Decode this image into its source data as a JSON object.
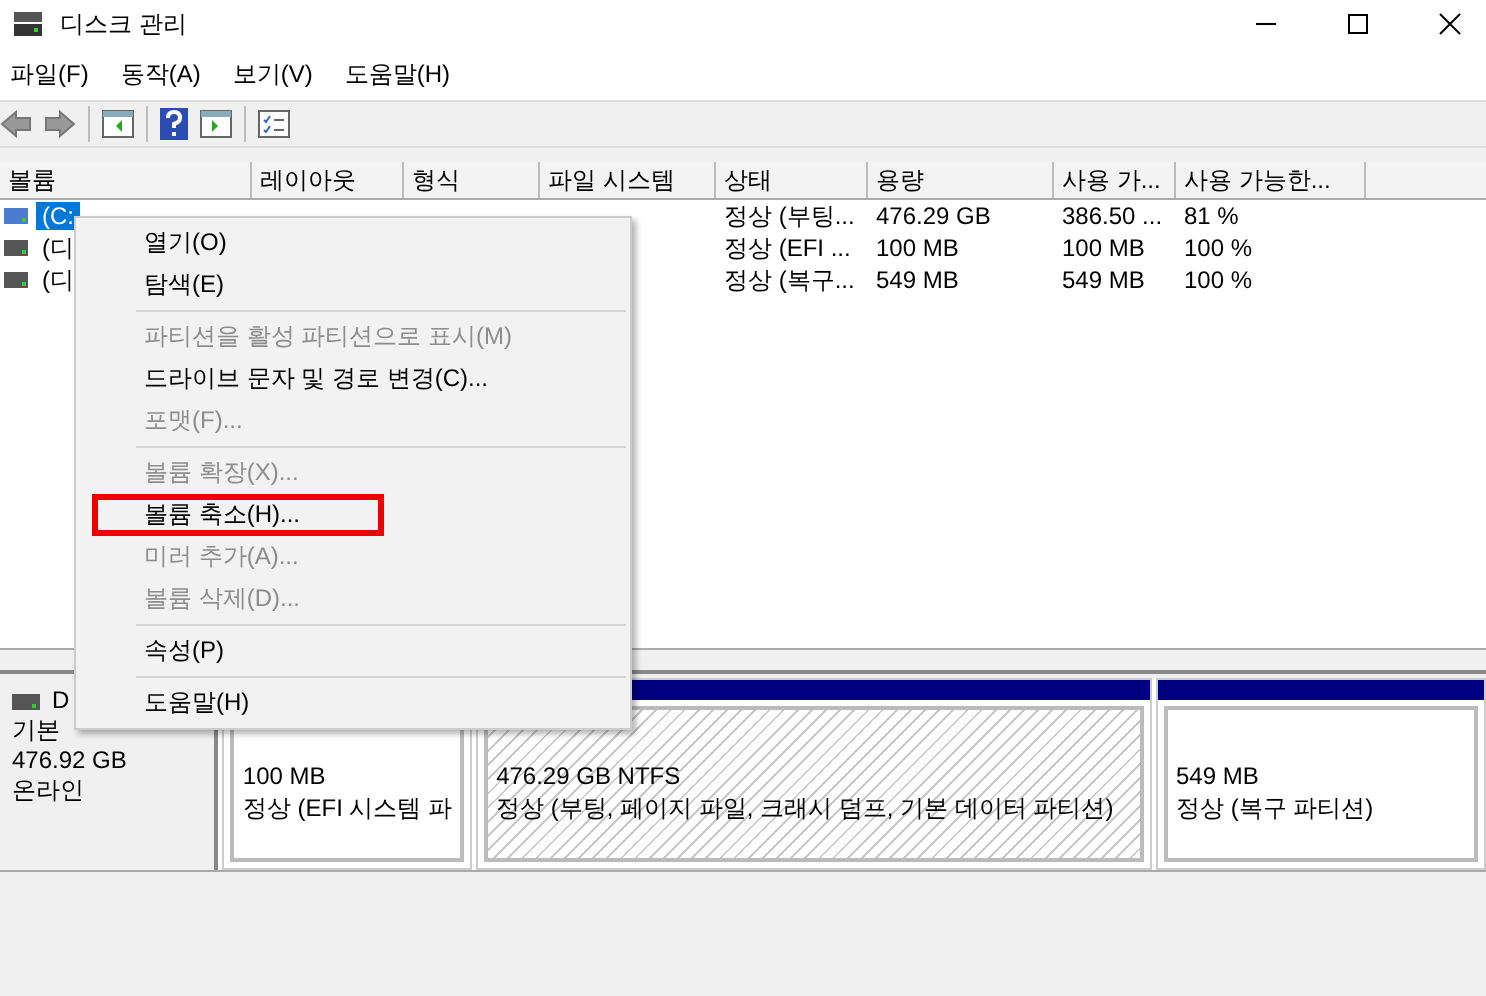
{
  "window": {
    "title": "디스크 관리"
  },
  "menu_bar": [
    "파일(F)",
    "동작(A)",
    "보기(V)",
    "도움말(H)"
  ],
  "table": {
    "columns": [
      "볼륨",
      "레이아웃",
      "형식",
      "파일 시스템",
      "상태",
      "용량",
      "사용 가...",
      "사용 가능한..."
    ],
    "rows": [
      {
        "selected": true,
        "cells": [
          "(C:",
          null,
          null,
          null,
          "정상 (부팅...",
          "476.29 GB",
          "386.50 ...",
          "81 %"
        ]
      },
      {
        "selected": false,
        "cells": [
          "(디",
          null,
          null,
          null,
          "정상 (EFI ...",
          "100 MB",
          "100 MB",
          "100 %"
        ]
      },
      {
        "selected": false,
        "cells": [
          "(디",
          null,
          null,
          null,
          "정상 (복구...",
          "549 MB",
          "549 MB",
          "100 %"
        ]
      }
    ]
  },
  "disk": {
    "name": "D",
    "type": "기본",
    "size": "476.92 GB",
    "status": "온라인",
    "partitions": [
      {
        "size": "100 MB",
        "status": "정상 (EFI 시스템 파",
        "hatched": false
      },
      {
        "size": "476.29 GB NTFS",
        "status": "정상 (부팅, 페이지 파일, 크래시 덤프, 기본 데이터 파티션)",
        "hatched": true
      },
      {
        "size": "549 MB",
        "status": "정상 (복구 파티션)",
        "hatched": false
      }
    ]
  },
  "context_menu": [
    {
      "label": "열기(O)",
      "disabled": false,
      "highlighted": false,
      "separator_before": false
    },
    {
      "label": "탐색(E)",
      "disabled": false,
      "highlighted": false,
      "separator_before": false
    },
    {
      "label": "파티션을 활성 파티션으로 표시(M)",
      "disabled": true,
      "highlighted": false,
      "separator_before": true
    },
    {
      "label": "드라이브 문자 및 경로 변경(C)...",
      "disabled": false,
      "highlighted": false,
      "separator_before": false
    },
    {
      "label": "포맷(F)...",
      "disabled": true,
      "highlighted": false,
      "separator_before": false
    },
    {
      "label": "볼륨 확장(X)...",
      "disabled": true,
      "highlighted": false,
      "separator_before": true
    },
    {
      "label": "볼륨 축소(H)...",
      "disabled": false,
      "highlighted": true,
      "separator_before": false
    },
    {
      "label": "미러 추가(A)...",
      "disabled": true,
      "highlighted": false,
      "separator_before": false
    },
    {
      "label": "볼륨 삭제(D)...",
      "disabled": true,
      "highlighted": false,
      "separator_before": false
    },
    {
      "label": "속성(P)",
      "disabled": false,
      "highlighted": false,
      "separator_before": true
    },
    {
      "label": "도움말(H)",
      "disabled": false,
      "highlighted": false,
      "separator_before": true
    }
  ]
}
